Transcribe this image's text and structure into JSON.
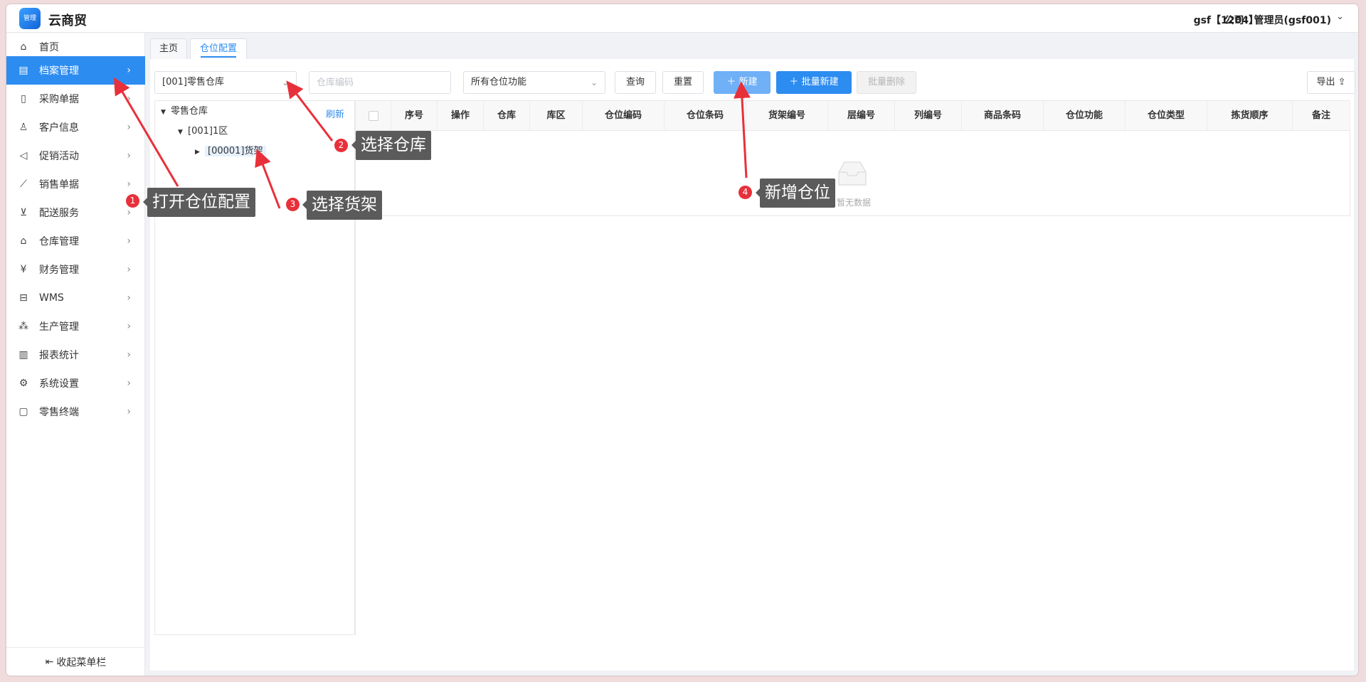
{
  "app": {
    "title": "云商贸",
    "logo_text": "管理",
    "user": "gsf【1204】",
    "company": "公司：管理员(gsf001)"
  },
  "sidebar": {
    "items": [
      {
        "label": "首页",
        "icon": "home-icon"
      },
      {
        "label": "档案管理",
        "icon": "archive-icon",
        "active": true
      },
      {
        "label": "采购单据",
        "icon": "document-icon"
      },
      {
        "label": "客户信息",
        "icon": "user-icon"
      },
      {
        "label": "促销活动",
        "icon": "megaphone-icon"
      },
      {
        "label": "销售单据",
        "icon": "chart-icon"
      },
      {
        "label": "配送服务",
        "icon": "cart-icon"
      },
      {
        "label": "仓库管理",
        "icon": "warehouse-icon"
      },
      {
        "label": "财务管理",
        "icon": "finance-icon"
      },
      {
        "label": "WMS",
        "icon": "truck-icon"
      },
      {
        "label": "生产管理",
        "icon": "network-icon"
      },
      {
        "label": "报表统计",
        "icon": "bar-chart-icon"
      },
      {
        "label": "系统设置",
        "icon": "gear-icon"
      },
      {
        "label": "零售终端",
        "icon": "bag-icon"
      }
    ],
    "collapse_label": "收起菜单栏"
  },
  "tabs": [
    {
      "label": "主页"
    },
    {
      "label": "仓位配置",
      "active": true
    }
  ],
  "toolbar": {
    "warehouse_select": "[001]零售仓库",
    "code_placeholder": "仓库编码",
    "function_select": "所有仓位功能",
    "query": "查询",
    "reset": "重置",
    "new": "新建",
    "batch_new": "批量新建",
    "batch_delete": "批量删除",
    "export": "导出"
  },
  "tree": {
    "refresh": "刷新",
    "nodes": [
      {
        "label": "零售仓库",
        "level": 0
      },
      {
        "label": "[001]1区",
        "level": 1
      },
      {
        "label": "[00001]货架",
        "level": 2,
        "selected": true
      }
    ]
  },
  "table": {
    "columns": [
      "序号",
      "操作",
      "仓库",
      "库区",
      "仓位编码",
      "仓位条码",
      "货架编号",
      "层编号",
      "列编号",
      "商品条码",
      "仓位功能",
      "仓位类型",
      "拣货顺序",
      "备注"
    ],
    "empty_text": "暂无数据"
  },
  "annotations": [
    {
      "num": "1",
      "text": "打开仓位配置"
    },
    {
      "num": "2",
      "text": "选择仓库"
    },
    {
      "num": "3",
      "text": "选择货架"
    },
    {
      "num": "4",
      "text": "新增仓位"
    }
  ],
  "colors": {
    "primary": "#2d8cf0",
    "annotation_bg": "#5b5b5b",
    "badge": "#e8303a",
    "arrow": "#e8303a"
  }
}
